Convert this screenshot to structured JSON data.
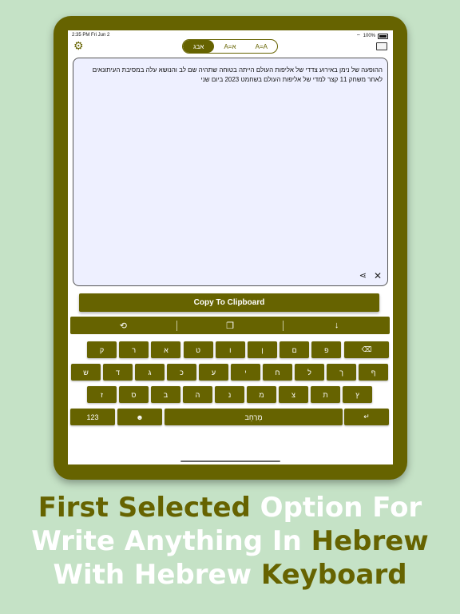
{
  "status": {
    "time": "2:35 PM  Fri Jun 2",
    "battery": "100%"
  },
  "tabs": [
    {
      "label": "אבג",
      "active": true
    },
    {
      "label": "A=א",
      "active": false
    },
    {
      "label": "A=A",
      "active": false
    }
  ],
  "editor": {
    "line1": "ההופעה של נימן באירוע צדדי של אליפות העולם הייתה בטוחה שתהיה שם לב והנושא עלה במסיבת העיתונאים",
    "line2": "לאחר משחק 11 קצר למדי של אליפות העולם בשחמט 2023 ביום שני"
  },
  "copy_button": "Copy To Clipboard",
  "toolbar": {
    "history": "⟲",
    "paste": "❐",
    "dismiss": "↓"
  },
  "keyboard": {
    "row1": [
      "ק",
      "ר",
      "א",
      "ט",
      "ו",
      "ן",
      "ם",
      "פ"
    ],
    "backspace": "⌫",
    "row2": [
      "ש",
      "ד",
      "ג",
      "כ",
      "ע",
      "י",
      "ח",
      "ל",
      "ך",
      "ף"
    ],
    "row3": [
      "ז",
      "ס",
      "ב",
      "ה",
      "נ",
      "מ",
      "צ",
      "ת",
      "ץ"
    ],
    "numbers": "123",
    "emoji": "☻",
    "space": "מְרַחֵב",
    "enter": "↵"
  },
  "caption": {
    "w1": "First Selected",
    "w2": " Option For",
    "w3": "Write Anything In ",
    "w4": "Hebrew",
    "w5": "With Hebrew ",
    "w6": " Keyboard"
  },
  "colors": {
    "accent": "#666300",
    "background": "#c5e2c6"
  }
}
